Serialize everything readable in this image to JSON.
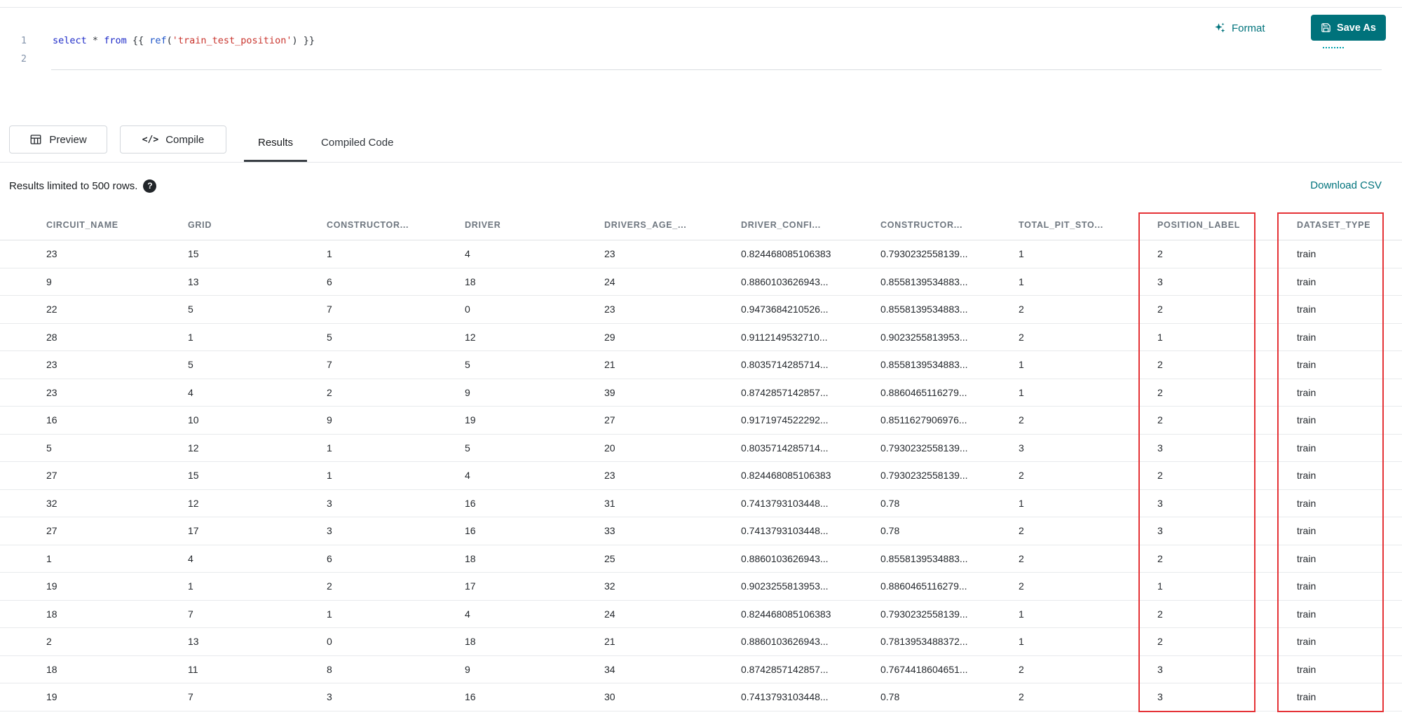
{
  "editor": {
    "lines": [
      {
        "number": "1",
        "tokens": [
          {
            "text": "select",
            "type": "keyword"
          },
          {
            "text": " ",
            "type": "plain"
          },
          {
            "text": "*",
            "type": "operator"
          },
          {
            "text": " ",
            "type": "plain"
          },
          {
            "text": "from",
            "type": "keyword"
          },
          {
            "text": " {{ ",
            "type": "plain"
          },
          {
            "text": "ref",
            "type": "function"
          },
          {
            "text": "(",
            "type": "plain"
          },
          {
            "text": "'train_test_position'",
            "type": "string"
          },
          {
            "text": ") }}",
            "type": "plain"
          }
        ]
      },
      {
        "number": "2",
        "tokens": []
      }
    ],
    "actions": {
      "format_label": "Format",
      "save_as_label": "Save As"
    }
  },
  "toolbar": {
    "preview_label": "Preview",
    "compile_label": "Compile",
    "compile_glyph": "</>",
    "tabs": [
      {
        "label": "Results",
        "active": true
      },
      {
        "label": "Compiled Code",
        "active": false
      }
    ]
  },
  "results": {
    "limit_note": "Results limited to 500 rows.",
    "help_glyph": "?",
    "download_csv_label": "Download CSV",
    "columns": [
      "CIRCUIT_NAME",
      "GRID",
      "CONSTRUCTOR...",
      "DRIVER",
      "DRIVERS_AGE_...",
      "DRIVER_CONFI...",
      "CONSTRUCTOR...",
      "TOTAL_PIT_STO...",
      "POSITION_LABEL",
      "DATASET_TYPE"
    ],
    "highlighted_columns": [
      "POSITION_LABEL",
      "DATASET_TYPE"
    ],
    "rows": [
      [
        "23",
        "15",
        "1",
        "4",
        "23",
        "0.824468085106383",
        "0.7930232558139...",
        "1",
        "2",
        "train"
      ],
      [
        "9",
        "13",
        "6",
        "18",
        "24",
        "0.8860103626943...",
        "0.8558139534883...",
        "1",
        "3",
        "train"
      ],
      [
        "22",
        "5",
        "7",
        "0",
        "23",
        "0.9473684210526...",
        "0.8558139534883...",
        "2",
        "2",
        "train"
      ],
      [
        "28",
        "1",
        "5",
        "12",
        "29",
        "0.9112149532710...",
        "0.9023255813953...",
        "2",
        "1",
        "train"
      ],
      [
        "23",
        "5",
        "7",
        "5",
        "21",
        "0.8035714285714...",
        "0.8558139534883...",
        "1",
        "2",
        "train"
      ],
      [
        "23",
        "4",
        "2",
        "9",
        "39",
        "0.8742857142857...",
        "0.8860465116279...",
        "1",
        "2",
        "train"
      ],
      [
        "16",
        "10",
        "9",
        "19",
        "27",
        "0.9171974522292...",
        "0.8511627906976...",
        "2",
        "2",
        "train"
      ],
      [
        "5",
        "12",
        "1",
        "5",
        "20",
        "0.8035714285714...",
        "0.7930232558139...",
        "3",
        "3",
        "train"
      ],
      [
        "27",
        "15",
        "1",
        "4",
        "23",
        "0.824468085106383",
        "0.7930232558139...",
        "2",
        "2",
        "train"
      ],
      [
        "32",
        "12",
        "3",
        "16",
        "31",
        "0.7413793103448...",
        "0.78",
        "1",
        "3",
        "train"
      ],
      [
        "27",
        "17",
        "3",
        "16",
        "33",
        "0.7413793103448...",
        "0.78",
        "2",
        "3",
        "train"
      ],
      [
        "1",
        "4",
        "6",
        "18",
        "25",
        "0.8860103626943...",
        "0.8558139534883...",
        "2",
        "2",
        "train"
      ],
      [
        "19",
        "1",
        "2",
        "17",
        "32",
        "0.9023255813953...",
        "0.8860465116279...",
        "2",
        "1",
        "train"
      ],
      [
        "18",
        "7",
        "1",
        "4",
        "24",
        "0.824468085106383",
        "0.7930232558139...",
        "1",
        "2",
        "train"
      ],
      [
        "2",
        "13",
        "0",
        "18",
        "21",
        "0.8860103626943...",
        "0.7813953488372...",
        "1",
        "2",
        "train"
      ],
      [
        "18",
        "11",
        "8",
        "9",
        "34",
        "0.8742857142857...",
        "0.7674418604651...",
        "2",
        "3",
        "train"
      ],
      [
        "19",
        "7",
        "3",
        "16",
        "30",
        "0.7413793103448...",
        "0.78",
        "2",
        "3",
        "train"
      ]
    ]
  },
  "colors": {
    "accent_teal": "#00727B",
    "highlight_red": "#E53236",
    "keyword_blue": "#1F2CC9",
    "string_red": "#C9352E"
  }
}
